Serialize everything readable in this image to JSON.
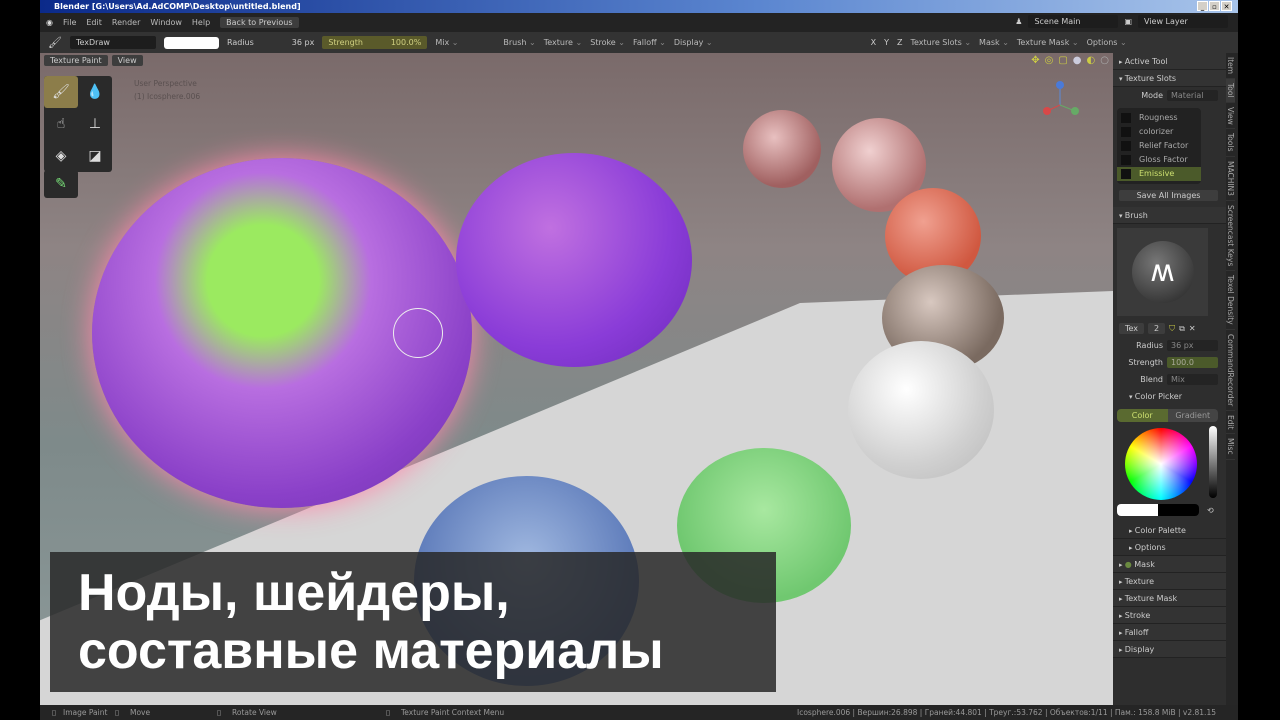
{
  "window": {
    "title": "Blender [G:\\Users\\Ad.AdCOMP\\Desktop\\untitled.blend]"
  },
  "menu": {
    "items": [
      "File",
      "Edit",
      "Render",
      "Window",
      "Help"
    ],
    "back": "Back to Previous",
    "scene": "Scene Main",
    "view_layer": "View Layer"
  },
  "toolheader": {
    "brush": "TexDraw",
    "radius_label": "Radius",
    "radius": "36 px",
    "strength_label": "Strength",
    "strength": "100.0%",
    "blend": "Mix",
    "menus": [
      "Brush",
      "Texture",
      "Stroke",
      "Falloff",
      "Display"
    ],
    "axes": [
      "X",
      "Y",
      "Z"
    ],
    "right_menus": [
      "Texture Slots",
      "Mask",
      "Texture Mask",
      "Options"
    ]
  },
  "viewport": {
    "mode": "Texture Paint",
    "view": "View",
    "info1": "User Perspective",
    "info2": "(1) Icosphere.006"
  },
  "caption": {
    "line1": "Ноды, шейдеры,",
    "line2": "составные материалы"
  },
  "sidebar": {
    "active_tool": "Active Tool",
    "texture_slots": "Texture Slots",
    "mode_label": "Mode",
    "mode": "Material",
    "slots": [
      "Rougness",
      "colorizer",
      "Relief Factor",
      "Gloss Factor",
      "Emissive"
    ],
    "save_all": "Save All Images",
    "brush": "Brush",
    "tex": "Tex",
    "tex_users": "2",
    "radius_label": "Radius",
    "radius": "36 px",
    "strength_label": "Strength",
    "strength": "100.0",
    "blend_label": "Blend",
    "blend": "Mix",
    "color_picker": "Color Picker",
    "color_tab": "Color",
    "gradient_tab": "Gradient",
    "color_palette": "Color Palette",
    "options": "Options",
    "panels": [
      "Mask",
      "Texture",
      "Texture Mask",
      "Stroke",
      "Falloff",
      "Display"
    ]
  },
  "tabs": [
    "Item",
    "Tool",
    "View",
    "Tools",
    "MACHIN3",
    "Screencast Keys",
    "Texel Density",
    "CommandRecorder",
    "Edit",
    "Misc"
  ],
  "status": {
    "left": "Image Paint",
    "move": "Move",
    "rotate": "Rotate View",
    "context": "Texture Paint Context Menu",
    "stats": "Icosphere.006 | Вершин:26.898 | Граней:44.801 | Треуг.:53.762 | Объектов:1/11 | Пам.: 158.8 MiB | v2.81.15"
  }
}
